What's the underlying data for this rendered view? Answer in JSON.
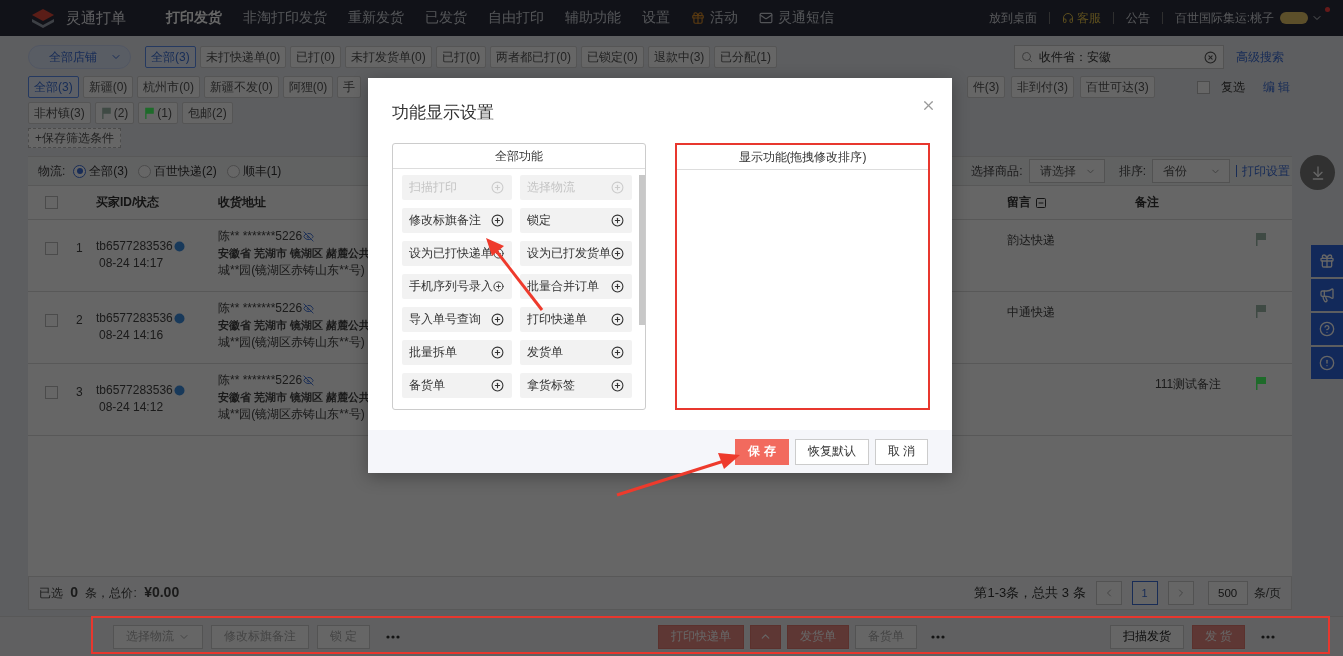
{
  "nav": {
    "brand": "灵通打单",
    "tabs": [
      {
        "label": "打印发货",
        "selected": true,
        "kind": "text"
      },
      {
        "label": "非淘打印发货",
        "selected": false,
        "kind": "text"
      },
      {
        "label": "重新发货",
        "selected": false,
        "kind": "text"
      },
      {
        "label": "已发货",
        "selected": false,
        "kind": "text"
      },
      {
        "label": "自由打印",
        "selected": false,
        "kind": "text"
      },
      {
        "label": "辅助功能",
        "selected": false,
        "kind": "text"
      },
      {
        "label": "设置",
        "selected": false,
        "kind": "text"
      },
      {
        "label": "活动",
        "selected": false,
        "kind": "gift"
      },
      {
        "label": "灵通短信",
        "selected": false,
        "kind": "mail"
      }
    ],
    "desktop": "放到桌面",
    "service": "客服",
    "notice": "公告",
    "user": "百世国际集运:桃子"
  },
  "filter": {
    "store": "全部店铺",
    "status_chips": [
      {
        "label": "全部(3)",
        "selected": true
      },
      {
        "label": "未打快递单(0)",
        "selected": false
      },
      {
        "label": "已打(0)",
        "selected": false
      },
      {
        "label": "未打发货单(0)",
        "selected": false
      },
      {
        "label": "已打(0)",
        "selected": false
      },
      {
        "label": "两者都已打(0)",
        "selected": false
      },
      {
        "label": "已锁定(0)",
        "selected": false
      },
      {
        "label": "退款中(3)",
        "selected": false
      },
      {
        "label": "已分配(1)",
        "selected": false
      }
    ],
    "search": {
      "value": "收件省：安徽"
    },
    "advanced_search": "高级搜索"
  },
  "tags": {
    "row_1_left": [
      {
        "label": "全部(3)",
        "selected": true
      },
      {
        "label": "新疆(0)",
        "selected": false
      },
      {
        "label": "杭州市(0)",
        "selected": false
      },
      {
        "label": "新疆不发(0)",
        "selected": false
      },
      {
        "label": "阿狸(0)",
        "selected": false
      },
      {
        "label": "手",
        "selected": false
      }
    ],
    "row_1_right": [
      {
        "label": "件(3)",
        "selected": false
      },
      {
        "label": "非到付(3)",
        "selected": false
      },
      {
        "label": "百世可达(3)",
        "selected": false
      }
    ],
    "row_2": [
      {
        "label": "非村镇(3)",
        "selected": false
      },
      {
        "label": "(2)",
        "selected": false,
        "color": "#3f4a44"
      },
      {
        "label": "(1)",
        "selected": false,
        "color": "#1e6b2a"
      },
      {
        "label": "包邮(2)",
        "selected": false
      }
    ],
    "multi_select": {
      "label": "复选",
      "checked": false
    },
    "edit": "编 辑",
    "save_filter": "+保存筛选条件"
  },
  "logistics": {
    "label": "物流:",
    "options": [
      {
        "label": "全部(3)",
        "selected": true
      },
      {
        "label": "百世快递(2)",
        "selected": false
      },
      {
        "label": "顺丰(1)",
        "selected": false
      }
    ],
    "product_label": "选择商品:",
    "product_select": "请选择",
    "sort_label": "排序:",
    "sort_select": "省份",
    "print_settings": "打印设置"
  },
  "table": {
    "select_all": {
      "checked": false
    },
    "columns": [
      "买家ID/状态",
      "收货地址",
      "留言",
      "备注"
    ],
    "rows": [
      {
        "checked": false,
        "index": "1",
        "buyer": "tb6577283536",
        "time": "08-24 14:17",
        "contact": "陈** *******5226",
        "address_1": "安徽省 芜湖市 镜湖区 赭麓公共",
        "address_2": "城**园(镜湖区赤铸山东**号)",
        "message": "韵达快递",
        "color": "#3f4a44"
      },
      {
        "checked": false,
        "index": "2",
        "buyer": "tb6577283536",
        "time": "08-24 14:16",
        "contact": "陈** *******5226",
        "address_1": "安徽省 芜湖市 镜湖区 赭麓公共",
        "address_2": "城**园(镜湖区赤铸山东**号)",
        "message": "中通快递",
        "color": "#3f4a44"
      },
      {
        "checked": false,
        "index": "3",
        "buyer": "tb6577283536",
        "time": "08-24 14:12",
        "contact": "陈** *******5226",
        "address_1": "安徽省 芜湖市 镜湖区 赭麓公共",
        "address_2": "城**园(镜湖区赤铸山东**号)",
        "note": "111测试备注",
        "color": "#1e6b2a"
      }
    ]
  },
  "summary": "已选 **0** 条，总价: **¥0.00**",
  "pager": {
    "range": "第1-3条，总共 3 条",
    "page": "1",
    "page_size": "500",
    "per_page": "条/页"
  },
  "actions_left": [
    {
      "kind": "dropdown",
      "label": "选择物流"
    },
    {
      "kind": "plain",
      "label": "修改标旗备注"
    },
    {
      "kind": "plain",
      "label": "锁 定"
    },
    {
      "kind": "more"
    }
  ],
  "actions_center": [
    {
      "kind": "danger",
      "label": "打印快递单"
    },
    {
      "kind": "danger-caret"
    },
    {
      "kind": "danger",
      "label": "发货单"
    },
    {
      "kind": "plain",
      "label": "备货单"
    },
    {
      "kind": "more"
    }
  ],
  "actions_right": [
    {
      "kind": "strong",
      "label": "扫描发货"
    },
    {
      "kind": "danger",
      "label": "发 货"
    },
    {
      "kind": "more"
    }
  ],
  "modal": {
    "title": "功能显示设置",
    "all_title": "全部功能",
    "display_title": "显示功能(拖拽修改排序)",
    "functions": [
      {
        "label": "扫描打印",
        "disabled": true
      },
      {
        "label": "选择物流",
        "disabled": true
      },
      {
        "label": "修改标旗备注",
        "disabled": false
      },
      {
        "label": "锁定",
        "disabled": false
      },
      {
        "label": "设为已打快递单",
        "disabled": false
      },
      {
        "label": "设为已打发货单",
        "disabled": false
      },
      {
        "label": "手机序列号录入",
        "disabled": false
      },
      {
        "label": "批量合并订单",
        "disabled": false
      },
      {
        "label": "导入单号查询",
        "disabled": false
      },
      {
        "label": "打印快递单",
        "disabled": false
      },
      {
        "label": "批量拆单",
        "disabled": false
      },
      {
        "label": "发货单",
        "disabled": false
      },
      {
        "label": "备货单",
        "disabled": false
      },
      {
        "label": "拿货标签",
        "disabled": false
      }
    ],
    "buttons": [
      {
        "kind": "primary",
        "label": "保 存"
      },
      {
        "kind": "default",
        "label": "恢复默认"
      },
      {
        "kind": "default",
        "label": "取 消"
      }
    ]
  }
}
